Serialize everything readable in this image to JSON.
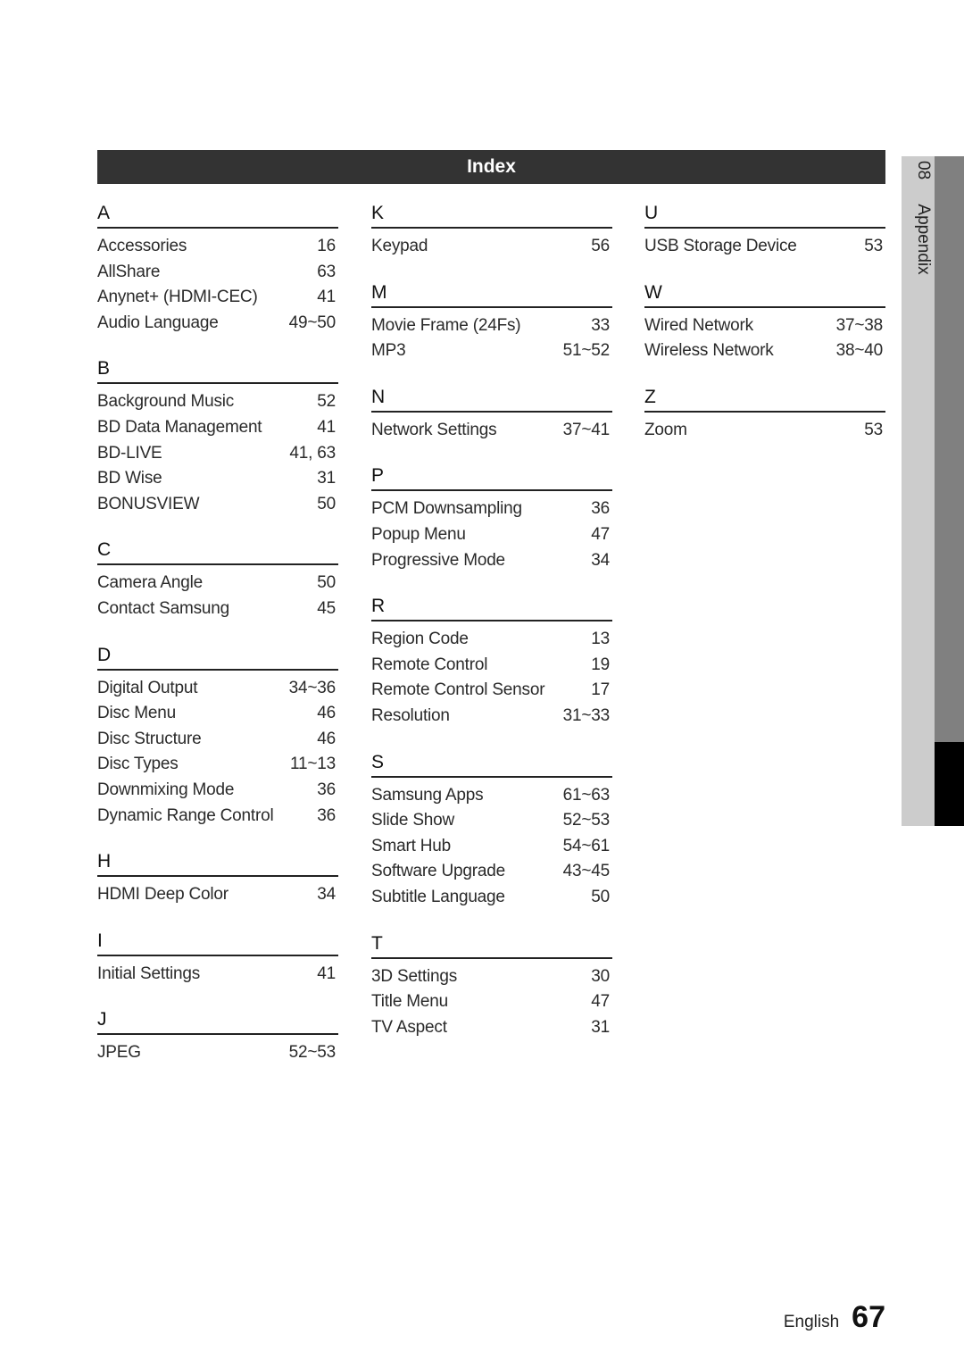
{
  "header": {
    "title": "Index"
  },
  "side_tab": {
    "chapter_number": "08",
    "chapter_name": "Appendix"
  },
  "footer": {
    "language": "English",
    "page_number": "67"
  },
  "columns": [
    {
      "sections": [
        {
          "letter": "A",
          "entries": [
            {
              "term": "Accessories",
              "pages": "16"
            },
            {
              "term": "AllShare",
              "pages": "63"
            },
            {
              "term": "Anynet+ (HDMI-CEC)",
              "pages": "41"
            },
            {
              "term": "Audio Language",
              "pages": "49~50"
            }
          ]
        },
        {
          "letter": "B",
          "entries": [
            {
              "term": "Background Music",
              "pages": "52"
            },
            {
              "term": "BD Data Management",
              "pages": "41"
            },
            {
              "term": "BD-LIVE",
              "pages": "41, 63"
            },
            {
              "term": "BD Wise",
              "pages": "31"
            },
            {
              "term": "BONUSVIEW",
              "pages": "50"
            }
          ]
        },
        {
          "letter": "C",
          "entries": [
            {
              "term": "Camera Angle",
              "pages": "50"
            },
            {
              "term": "Contact Samsung",
              "pages": "45"
            }
          ]
        },
        {
          "letter": "D",
          "entries": [
            {
              "term": "Digital Output",
              "pages": "34~36"
            },
            {
              "term": "Disc Menu",
              "pages": "46"
            },
            {
              "term": "Disc Structure",
              "pages": "46"
            },
            {
              "term": "Disc Types",
              "pages": "11~13"
            },
            {
              "term": "Downmixing Mode",
              "pages": "36"
            },
            {
              "term": "Dynamic Range Control",
              "pages": "36"
            }
          ]
        },
        {
          "letter": "H",
          "entries": [
            {
              "term": "HDMI Deep Color",
              "pages": "34"
            }
          ]
        },
        {
          "letter": "I",
          "entries": [
            {
              "term": "Initial Settings",
              "pages": "41"
            }
          ]
        },
        {
          "letter": "J",
          "entries": [
            {
              "term": "JPEG",
              "pages": "52~53"
            }
          ]
        }
      ]
    },
    {
      "sections": [
        {
          "letter": "K",
          "entries": [
            {
              "term": "Keypad",
              "pages": "56"
            }
          ]
        },
        {
          "letter": "M",
          "entries": [
            {
              "term": "Movie Frame (24Fs)",
              "pages": "33"
            },
            {
              "term": "MP3",
              "pages": "51~52"
            }
          ]
        },
        {
          "letter": "N",
          "entries": [
            {
              "term": "Network Settings",
              "pages": "37~41"
            }
          ]
        },
        {
          "letter": "P",
          "entries": [
            {
              "term": "PCM Downsampling",
              "pages": "36"
            },
            {
              "term": "Popup Menu",
              "pages": "47"
            },
            {
              "term": "Progressive Mode",
              "pages": "34"
            }
          ]
        },
        {
          "letter": "R",
          "entries": [
            {
              "term": "Region Code",
              "pages": "13"
            },
            {
              "term": "Remote Control",
              "pages": "19"
            },
            {
              "term": "Remote Control Sensor",
              "pages": "17"
            },
            {
              "term": "Resolution",
              "pages": "31~33"
            }
          ]
        },
        {
          "letter": "S",
          "entries": [
            {
              "term": "Samsung Apps",
              "pages": "61~63"
            },
            {
              "term": "Slide Show",
              "pages": "52~53"
            },
            {
              "term": "Smart Hub",
              "pages": "54~61"
            },
            {
              "term": "Software Upgrade",
              "pages": "43~45"
            },
            {
              "term": "Subtitle Language",
              "pages": "50"
            }
          ]
        },
        {
          "letter": "T",
          "entries": [
            {
              "term": "3D Settings",
              "pages": "30"
            },
            {
              "term": "Title Menu",
              "pages": "47"
            },
            {
              "term": "TV Aspect",
              "pages": "31"
            }
          ]
        }
      ]
    },
    {
      "sections": [
        {
          "letter": "U",
          "entries": [
            {
              "term": "USB Storage Device",
              "pages": "53"
            }
          ]
        },
        {
          "letter": "W",
          "entries": [
            {
              "term": "Wired Network",
              "pages": "37~38"
            },
            {
              "term": "Wireless Network",
              "pages": "38~40"
            }
          ]
        },
        {
          "letter": "Z",
          "entries": [
            {
              "term": "Zoom",
              "pages": "53"
            }
          ]
        }
      ]
    }
  ]
}
